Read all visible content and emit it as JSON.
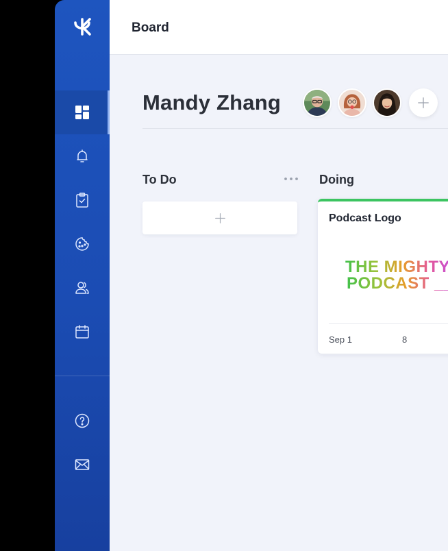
{
  "topbar": {
    "title": "Board"
  },
  "sidebar": {
    "items": [
      {
        "icon": "dashboard-icon",
        "active": true
      },
      {
        "icon": "bell-icon",
        "active": false
      },
      {
        "icon": "clipboard-check-icon",
        "active": false
      },
      {
        "icon": "cookie-icon",
        "active": false
      },
      {
        "icon": "users-icon",
        "active": false
      },
      {
        "icon": "calendar-icon",
        "active": false
      }
    ],
    "bottom_items": [
      {
        "icon": "help-icon"
      },
      {
        "icon": "mail-icon"
      }
    ]
  },
  "board": {
    "owner": "Mandy Zhang",
    "members": [
      "avatar-man-glasses",
      "avatar-woman-glasses",
      "avatar-woman-dark-hair"
    ],
    "columns": [
      {
        "title": "To Do",
        "cards": []
      },
      {
        "title": "Doing",
        "cards": [
          {
            "title": "Podcast Logo",
            "image_text_line1": "THE MIGHTY",
            "image_text_line2": "PODCAST",
            "date": "Sep 1",
            "count": "8"
          }
        ]
      }
    ]
  },
  "colors": {
    "sidebar": "#1e55bf",
    "background": "#f1f3fa",
    "card_accent": "#3cc461"
  }
}
